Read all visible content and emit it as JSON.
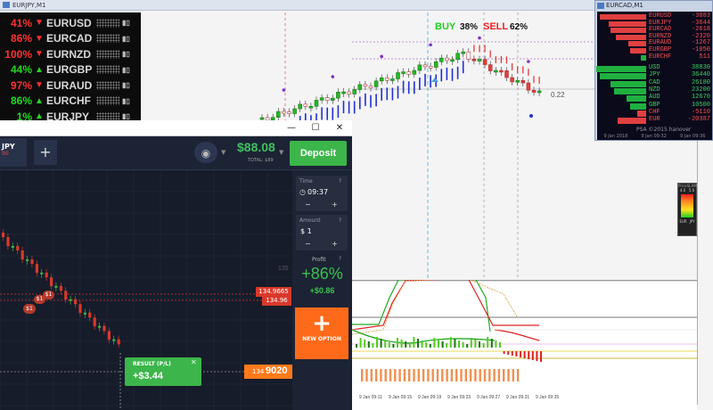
{
  "mt4": {
    "window_title": "EURJPY,M1",
    "currency_strength": [
      {
        "pct": "41%",
        "arrow": "▼",
        "pair": "EURUSD",
        "color": "#ff3030"
      },
      {
        "pct": "86%",
        "arrow": "▼",
        "pair": "EURCAD",
        "color": "#ff3030"
      },
      {
        "pct": "100%",
        "arrow": "▼",
        "pair": "EURNZD",
        "color": "#ff3030"
      },
      {
        "pct": "44%",
        "arrow": "▲",
        "pair": "EURGBP",
        "color": "#22d822"
      },
      {
        "pct": "97%",
        "arrow": "▼",
        "pair": "EURAUD",
        "color": "#ff3030"
      },
      {
        "pct": "86%",
        "arrow": "▲",
        "pair": "EURCHF",
        "color": "#22d822"
      },
      {
        "pct": "1%",
        "arrow": "▲",
        "pair": "EURJPY",
        "color": "#22d822"
      }
    ],
    "signal": {
      "buy_label": "BUY",
      "buy_pct": "38%",
      "sell_label": "SELL",
      "sell_pct": "62%"
    },
    "price_label": "0.22",
    "time_labels": [
      "9 Jan 09:11",
      "9 Jan 09:15",
      "9 Jan 09:19",
      "9 Jan 09:23",
      "9 Jan 09:27",
      "9 Jan 09:31",
      "9 Jan 09:35"
    ],
    "ind_box": {
      "title": "PriceSLAM",
      "v1": "4.0",
      "v2": "5.0",
      "cur1": "EUR",
      "cur2": "JPY"
    }
  },
  "eurcad": {
    "window_title": "EURCAD,M1",
    "pairs": [
      {
        "name": "EURUSD",
        "value": "-3883"
      },
      {
        "name": "EURJPY",
        "value": "-3644"
      },
      {
        "name": "EURCAD",
        "value": "-2618"
      },
      {
        "name": "EURNZD",
        "value": "-2320"
      },
      {
        "name": "EURAUD",
        "value": "-1267"
      },
      {
        "name": "EURGBP",
        "value": "-1050"
      },
      {
        "name": "EURCHF",
        "value": "511"
      }
    ],
    "currencies": [
      {
        "name": "USD",
        "value": "38830"
      },
      {
        "name": "JPY",
        "value": "36440"
      },
      {
        "name": "CAD",
        "value": "26180"
      },
      {
        "name": "NZD",
        "value": "23200"
      },
      {
        "name": "AUD",
        "value": "12670"
      },
      {
        "name": "GBP",
        "value": "10500"
      },
      {
        "name": "CHF",
        "value": "-5110"
      },
      {
        "name": "EUR",
        "value": "-20387"
      }
    ],
    "copyright": "PSA ©2015 hanover",
    "time_labels": [
      "9 Jan 2018",
      "9 Jan 09:32",
      "9 Jan 09:36"
    ]
  },
  "iq": {
    "tab_pair": "JPY",
    "tab_sub": "90",
    "balance": "$88.08",
    "total_label": "TOTAL: $89",
    "deposit_label": "Deposit",
    "time_label": "Time",
    "time_value": "09:37",
    "amount_label": "Amount",
    "amount_value": "$ 1",
    "profit_label": "Profit",
    "profit_pct": "+86%",
    "profit_value": "+$0.86",
    "new_option_label": "NEW OPTION",
    "price_tag_1": "134.9665",
    "price_tag_2": "134.96",
    "current_price_small": "134",
    "current_price_big": "9020",
    "result_label": "RESULT (P/L)",
    "result_value": "+$3.44",
    "grid_label": "135",
    "trade_markers": [
      "$1",
      "$1",
      "$1"
    ],
    "colors": {
      "accent_green": "#3cb54a",
      "accent_orange": "#ff6a1a",
      "price_red": "#d8392b"
    }
  }
}
